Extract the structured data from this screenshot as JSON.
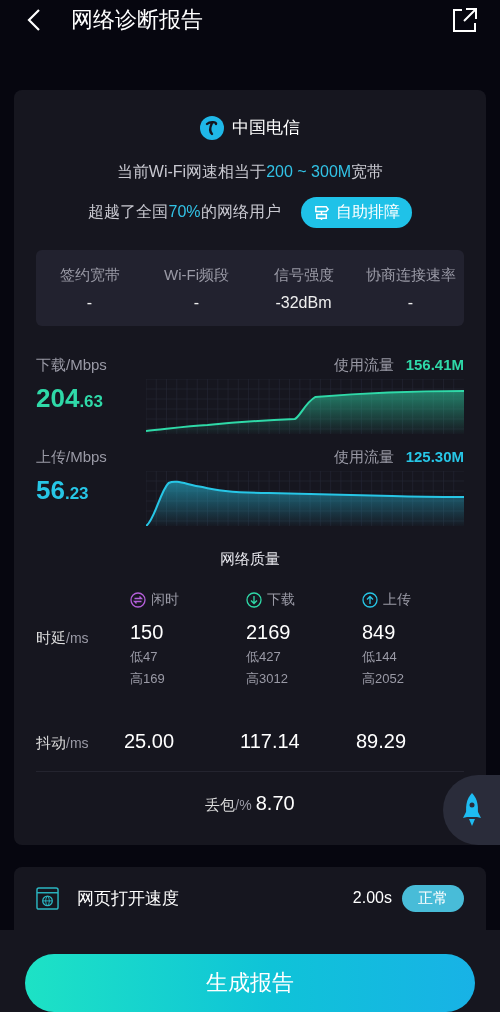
{
  "header": {
    "title": "网络诊断报告"
  },
  "provider": {
    "name": "中国电信"
  },
  "speed": {
    "prefix": "当前Wi-Fi网速相当于",
    "value": "200 ~ 300M",
    "suffix": "宽带"
  },
  "rank": {
    "prefix": "超越了全国",
    "value": "70%",
    "suffix": "的网络用户",
    "button": "自助排障"
  },
  "info": [
    {
      "label": "签约宽带",
      "value": "-"
    },
    {
      "label": "Wi-Fi频段",
      "value": "-"
    },
    {
      "label": "信号强度",
      "value": "-32dBm"
    },
    {
      "label": "协商连接速率",
      "value": "-"
    }
  ],
  "throughput": [
    {
      "kind": "download",
      "label": "下载/Mbps",
      "value_int": "204",
      "value_dec": ".63",
      "usage_label": "使用流量",
      "usage": "156.41M"
    },
    {
      "kind": "upload",
      "label": "上传/Mbps",
      "value_int": "56",
      "value_dec": ".23",
      "usage_label": "使用流量",
      "usage": "125.30M"
    }
  ],
  "quality": {
    "title": "网络质量",
    "columns": [
      {
        "kind": "idle",
        "label": "闲时"
      },
      {
        "kind": "download",
        "label": "下载"
      },
      {
        "kind": "upload",
        "label": "上传"
      }
    ],
    "latency": {
      "label": "时延",
      "unit": "/ms",
      "values": [
        {
          "main": "150",
          "low": "低47",
          "high": "高169"
        },
        {
          "main": "2169",
          "low": "低427",
          "high": "高3012"
        },
        {
          "main": "849",
          "low": "低144",
          "high": "高2052"
        }
      ]
    },
    "jitter": {
      "label": "抖动",
      "unit": "/ms",
      "values": [
        "25.00",
        "117.14",
        "89.29"
      ]
    },
    "loss": {
      "label": "丢包",
      "unit": "/%",
      "value": "8.70"
    }
  },
  "page_speed": {
    "label": "网页打开速度",
    "value": "2.00s",
    "status": "正常"
  },
  "generate_button": "生成报告"
}
